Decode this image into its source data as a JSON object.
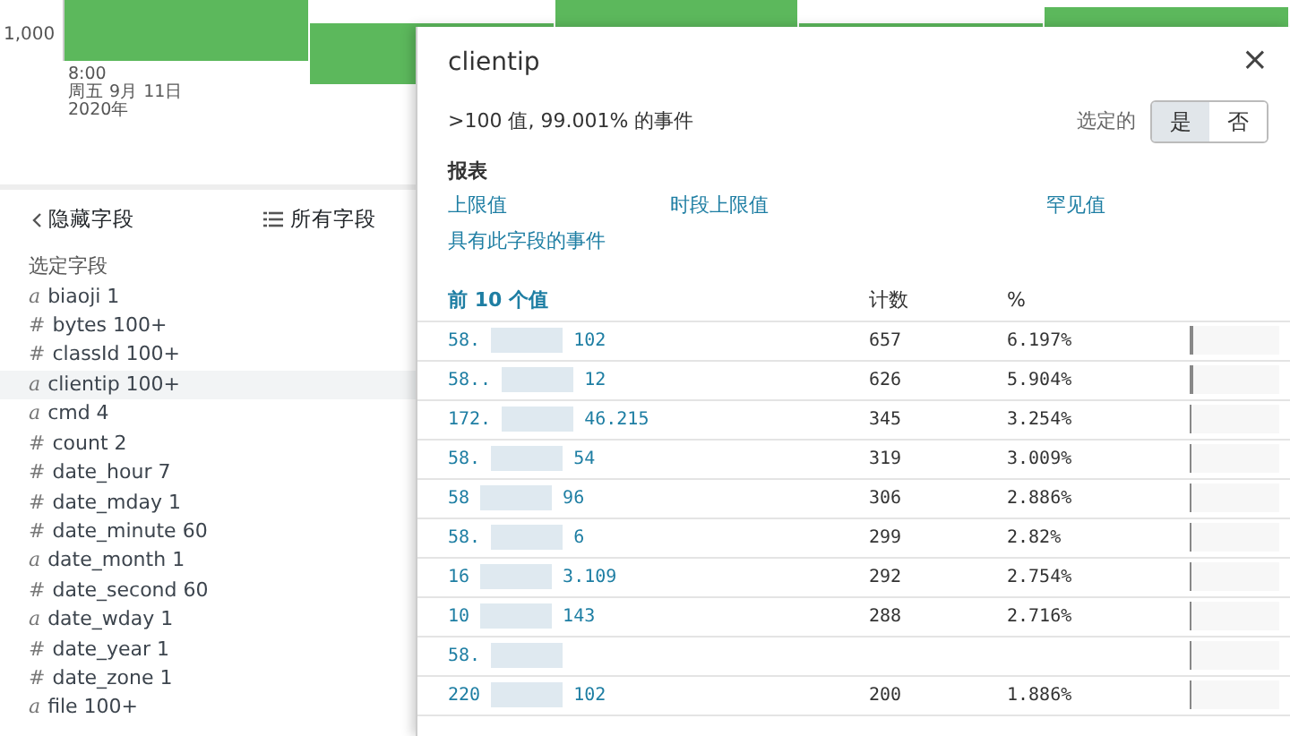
{
  "chart": {
    "ytick": "1,000",
    "time_label": [
      "8:00",
      "周五 9月 11日",
      "2020年"
    ]
  },
  "close_label": "×",
  "sidebar": {
    "hide_link": "隐藏字段",
    "all_fields_link": "所有字段",
    "section_title": "选定字段",
    "fields": [
      {
        "kind": "string",
        "symbol": "a",
        "name": "biaoji",
        "count": "1",
        "selected": false
      },
      {
        "kind": "number",
        "symbol": "#",
        "name": "bytes",
        "count": "100+",
        "selected": false
      },
      {
        "kind": "number",
        "symbol": "#",
        "name": "classId",
        "count": "100+",
        "selected": false
      },
      {
        "kind": "string",
        "symbol": "a",
        "name": "clientip",
        "count": "100+",
        "selected": true
      },
      {
        "kind": "string",
        "symbol": "a",
        "name": "cmd",
        "count": "4",
        "selected": false
      },
      {
        "kind": "number",
        "symbol": "#",
        "name": "count",
        "count": "2",
        "selected": false
      },
      {
        "kind": "number",
        "symbol": "#",
        "name": "date_hour",
        "count": "7",
        "selected": false
      },
      {
        "kind": "number",
        "symbol": "#",
        "name": "date_mday",
        "count": "1",
        "selected": false
      },
      {
        "kind": "number",
        "symbol": "#",
        "name": "date_minute",
        "count": "60",
        "selected": false
      },
      {
        "kind": "string",
        "symbol": "a",
        "name": "date_month",
        "count": "1",
        "selected": false
      },
      {
        "kind": "number",
        "symbol": "#",
        "name": "date_second",
        "count": "60",
        "selected": false
      },
      {
        "kind": "string",
        "symbol": "a",
        "name": "date_wday",
        "count": "1",
        "selected": false
      },
      {
        "kind": "number",
        "symbol": "#",
        "name": "date_year",
        "count": "1",
        "selected": false
      },
      {
        "kind": "number",
        "symbol": "#",
        "name": "date_zone",
        "count": "1",
        "selected": false
      },
      {
        "kind": "string",
        "symbol": "a",
        "name": "file",
        "count": "100+",
        "selected": false
      }
    ]
  },
  "popup": {
    "title": "clientip",
    "summary": ">100 值, 99.001% 的事件",
    "selected_label": "选定的",
    "toggle": [
      {
        "label": "是",
        "selected": true
      },
      {
        "label": "否",
        "selected": false
      }
    ],
    "reports_title": "报表",
    "reports": [
      "上限值",
      "时段上限值",
      "罕见值",
      "具有此字段的事件"
    ],
    "table": {
      "columns": [
        "前 10 个值",
        "计数",
        "%"
      ],
      "rows": [
        {
          "value_start": "58.",
          "value_end": "102",
          "count": "657",
          "percent": "6.197%",
          "level": 0.062
        },
        {
          "value_start": "58..",
          "value_end": "12",
          "count": "626",
          "percent": "5.904%",
          "level": 0.059
        },
        {
          "value_start": "172.",
          "value_end": "46.215",
          "count": "345",
          "percent": "3.254%",
          "level": 0.033
        },
        {
          "value_start": "58.",
          "value_end": "54",
          "count": "319",
          "percent": "3.009%",
          "level": 0.03
        },
        {
          "value_start": "58",
          "value_end": "96",
          "count": "306",
          "percent": "2.886%",
          "level": 0.029
        },
        {
          "value_start": "58.",
          "value_end": "6",
          "count": "299",
          "percent": "2.82%",
          "level": 0.028
        },
        {
          "value_start": "16",
          "value_end": "3.109",
          "count": "292",
          "percent": "2.754%",
          "level": 0.028
        },
        {
          "value_start": "10",
          "value_end": "143",
          "count": "288",
          "percent": "2.716%",
          "level": 0.027
        },
        {
          "value_start": "58.",
          "level": 0.027
        },
        {
          "value_start": "220",
          "value_end": "102",
          "count": "200",
          "percent": "1.886%",
          "level": 0.019
        }
      ]
    }
  }
}
